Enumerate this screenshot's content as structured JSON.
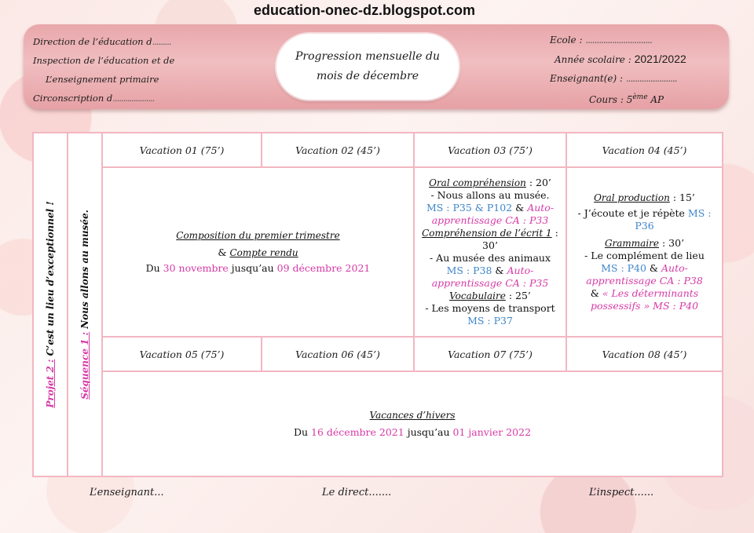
{
  "site": "education-onec-dz.blogspot.com",
  "header": {
    "left_lines": [
      "Direction de l’éducation d",
      "Inspection de  l’éducation et de",
      "L’enseignement primaire",
      "Circonscription d"
    ],
    "title_line1": "Progression mensuelle du",
    "title_line2": "mois de décembre",
    "ecole_label": "Ecole :",
    "annee_label": "Année scolaire :",
    "annee_value": "2021/2022",
    "enseignant_label": "Enseignant(e) :",
    "cours_label": "Cours :",
    "cours_value": "5",
    "cours_sup": "ème",
    "cours_suffix": "AP"
  },
  "side": {
    "projet_label": "Projet 2 :",
    "projet_text": " C’est un lieu d’exceptionnel !",
    "sequence_label": "Séquence 1 :",
    "sequence_text": " Nous allons au musée."
  },
  "vacations_row1": [
    "Vacation 01 (75’)",
    "Vacation 02 (45’)",
    "Vacation 03 (75’)",
    "Vacation 04 (45’)"
  ],
  "vacations_row2": [
    "Vacation 05 (75’)",
    "Vacation 06 (45’)",
    "Vacation 07 (75’)",
    "Vacation 08 (45’)"
  ],
  "composition": {
    "title": "Composition du premier trimestre",
    "subtitle_amp": "& ",
    "subtitle": "Compte rendu",
    "du": "Du ",
    "start": "30 novembre",
    "mid": " jusqu’au ",
    "end": "09 décembre 2021"
  },
  "vac03": {
    "oral_title": "Oral compréhension",
    "oral_time": " : 20’",
    "oral_line": "- Nous allons au musée.",
    "oral_ms": "MS : P35 & P102",
    "amp": " & ",
    "oral_ca": "Auto-apprentissage CA : P33",
    "ecrit_title": "Compréhension de l’écrit 1",
    "ecrit_time": " : 30’",
    "ecrit_line": "- Au musée des animaux",
    "ecrit_ms": "MS : P38",
    "ecrit_ca": "Auto-apprentissage CA : P35",
    "vocab_title": "Vocabulaire",
    "vocab_time": " : 25’",
    "vocab_line": "- Les moyens de transport",
    "vocab_ms": "MS : P37"
  },
  "vac04": {
    "prod_title": "Oral production",
    "prod_time": " : 15’",
    "prod_line": "- J’écoute et je répète ",
    "prod_ms": "MS : P36",
    "gram_title": "Grammaire",
    "gram_time": " : 30’",
    "gram_line": "-  Le complément de lieu",
    "gram_ms": "MS : P40",
    "amp": " & ",
    "gram_ca": "Auto-apprentissage CA : P38",
    "gram_extra": "« Les déterminants possessifs » MS : P40"
  },
  "vacances": {
    "title": "Vacances d’hivers",
    "du": "Du ",
    "start": "16 décembre 2021",
    "mid": " jusqu’au ",
    "end": "01 janvier 2022"
  },
  "footer": {
    "enseignant": "L’enseignant...",
    "directeur": "Le direct.......",
    "inspecteur": "L’inspect......"
  },
  "colors": {
    "pink_text": "#d63aa6",
    "blue_text": "#3f86c8",
    "border": "#f2b7c2",
    "banner": "#e8a7ab"
  }
}
